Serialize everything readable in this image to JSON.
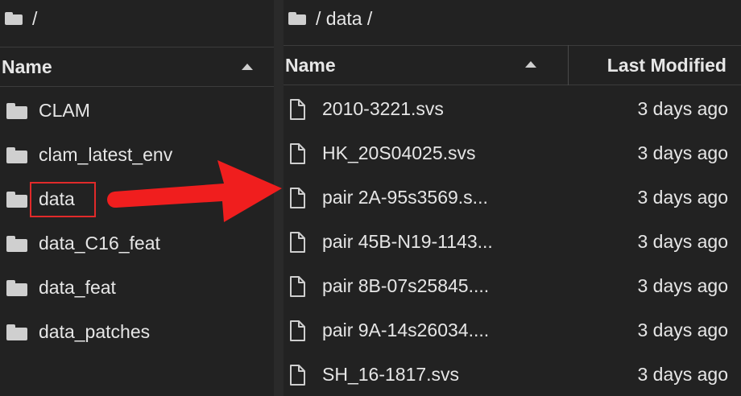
{
  "left_pane": {
    "breadcrumb": "/",
    "header": {
      "name_label": "Name"
    },
    "items": [
      {
        "label": "CLAM",
        "icon": "folder-icon"
      },
      {
        "label": "clam_latest_env",
        "icon": "folder-icon"
      },
      {
        "label": "data",
        "icon": "folder-icon"
      },
      {
        "label": "data_C16_feat",
        "icon": "folder-icon"
      },
      {
        "label": "data_feat",
        "icon": "folder-icon"
      },
      {
        "label": "data_patches",
        "icon": "folder-icon"
      }
    ]
  },
  "right_pane": {
    "breadcrumb": "/ data /",
    "header": {
      "name_label": "Name",
      "modified_label": "Last Modified"
    },
    "files": [
      {
        "name": "2010-3221.svs",
        "modified": "3 days ago",
        "icon": "file-icon"
      },
      {
        "name": "HK_20S04025.svs",
        "modified": "3 days ago",
        "icon": "file-icon"
      },
      {
        "name": "pair 2A-95s3569.s...",
        "modified": "3 days ago",
        "icon": "file-icon"
      },
      {
        "name": "pair 45B-N19-1143...",
        "modified": "3 days ago",
        "icon": "file-icon"
      },
      {
        "name": "pair 8B-07s25845....",
        "modified": "3 days ago",
        "icon": "file-icon"
      },
      {
        "name": "pair 9A-14s26034....",
        "modified": "3 days ago",
        "icon": "file-icon"
      },
      {
        "name": "SH_16-1817.svs",
        "modified": "3 days ago",
        "icon": "file-icon"
      }
    ]
  },
  "annotation": {
    "highlight_color": "#e12a2a",
    "arrow_color": "#f01e1e"
  },
  "colors": {
    "background": "#222222",
    "text": "#e6e6e6",
    "icon": "#cfcfcf"
  }
}
